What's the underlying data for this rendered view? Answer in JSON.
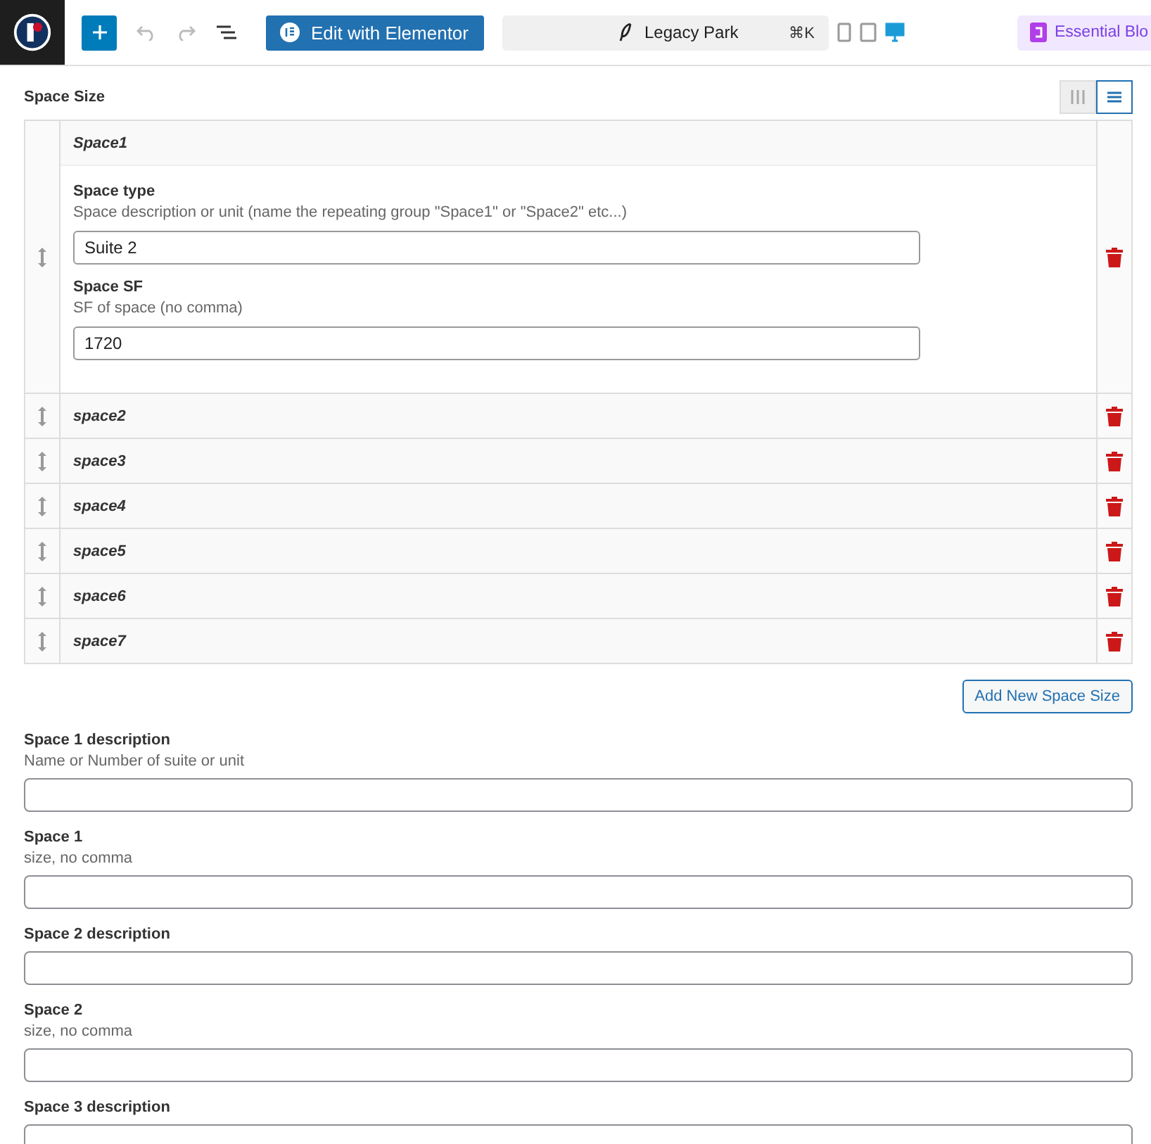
{
  "toolbar": {
    "edit_button": "Edit with Elementor",
    "document": {
      "title": "Legacy Park",
      "shortcut": "⌘K"
    },
    "devices": [
      {
        "kind": "mobile",
        "selected": false
      },
      {
        "kind": "tablet",
        "selected": false
      },
      {
        "kind": "desktop",
        "selected": true
      }
    ],
    "plugin_button": "Essential Blo"
  },
  "repeater": {
    "label": "Space Size",
    "layouts": [
      {
        "kind": "table",
        "selected": false
      },
      {
        "kind": "block",
        "selected": true
      }
    ],
    "rows": [
      {
        "title": "Space1",
        "expanded": true,
        "fields": [
          {
            "label": "Space type",
            "hint": "Space description or unit (name the repeating group \"Space1\" or \"Space2\" etc...)",
            "value": "Suite 2"
          },
          {
            "label": "Space SF",
            "hint": "SF of space (no comma)",
            "value": "1720"
          }
        ]
      },
      {
        "title": "space2",
        "expanded": false
      },
      {
        "title": "space3",
        "expanded": false
      },
      {
        "title": "space4",
        "expanded": false
      },
      {
        "title": "space5",
        "expanded": false
      },
      {
        "title": "space6",
        "expanded": false
      },
      {
        "title": "space7",
        "expanded": false
      }
    ],
    "add_button": "Add New Space Size"
  },
  "fields": [
    {
      "label": "Space 1 description",
      "hint": "Name or Number of suite or unit"
    },
    {
      "label": "Space 1",
      "hint": "size, no comma"
    },
    {
      "label": "Space 2 description"
    },
    {
      "label": "Space 2",
      "hint": "size, no comma"
    },
    {
      "label": "Space 3 description"
    }
  ]
}
